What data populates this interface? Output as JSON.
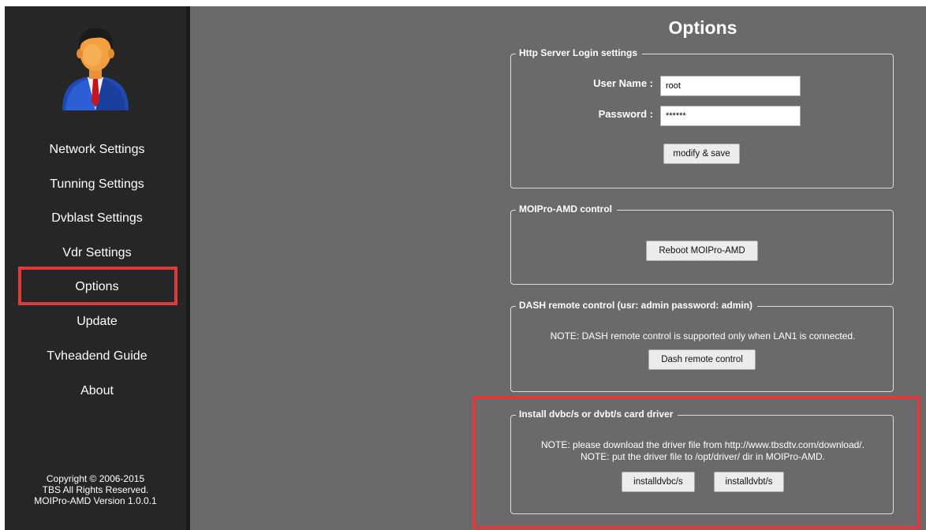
{
  "sidebar": {
    "items": [
      {
        "label": "Network Settings"
      },
      {
        "label": "Tunning Settings"
      },
      {
        "label": "Dvblast Settings"
      },
      {
        "label": "Vdr Settings"
      },
      {
        "label": "Options"
      },
      {
        "label": "Update"
      },
      {
        "label": "Tvheadend Guide"
      },
      {
        "label": "About"
      }
    ],
    "selected": "Options",
    "copyright": [
      "Copyright © 2006-2015",
      "TBS All Rights Reserved.",
      "MOIPro-AMD Version 1.0.0.1"
    ]
  },
  "page_title": "Options",
  "login_panel": {
    "legend": "Http Server Login settings",
    "username_label": "User Name :",
    "username_value": "root",
    "password_label": "Password :",
    "password_value": "******",
    "save_button": "modify & save"
  },
  "control_panel": {
    "legend": "MOIPro-AMD control",
    "reboot_button": "Reboot MOIPro-AMD"
  },
  "dash_panel": {
    "legend": "DASH remote control (usr: admin password: admin)",
    "note": "NOTE: DASH remote control is supported only when LAN1 is connected.",
    "button": "Dash remote control"
  },
  "driver_panel": {
    "legend": "Install dvbc/s or dvbt/s card driver",
    "note1": "NOTE: please download the driver file from http://www.tbsdtv.com/download/.",
    "note2": "NOTE: put the driver file to /opt/driver/ dir in MOIPro-AMD.",
    "button_dvbc": "installdvbc/s",
    "button_dvbt": "installdvbt/s"
  },
  "colors": {
    "background": "#6a6a6a",
    "sidebar": "#262626",
    "highlight": "#e03a3a"
  }
}
